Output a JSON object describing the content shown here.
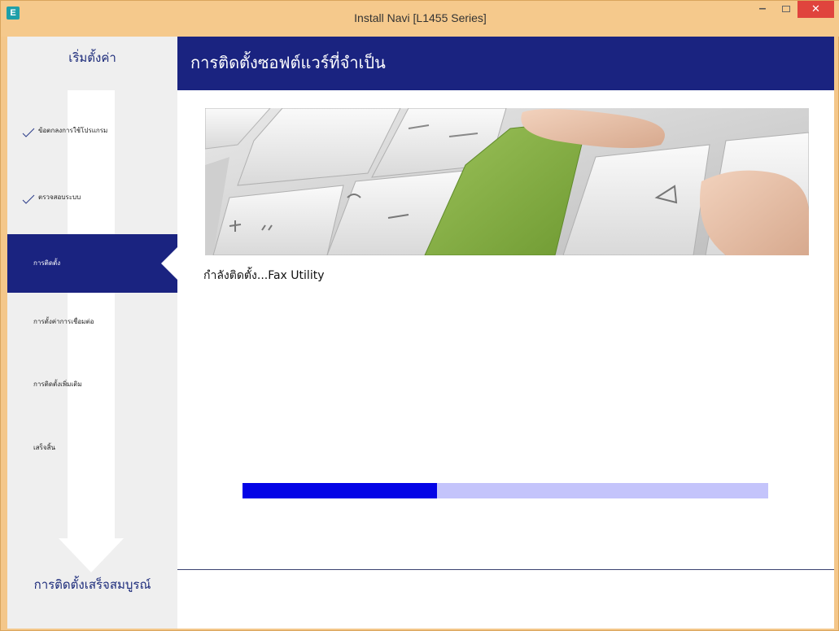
{
  "window": {
    "title": "Install Navi [L1455 Series]",
    "app_icon_letter": "E",
    "minimize_glyph": "–",
    "close_glyph": "✕"
  },
  "sidebar": {
    "title": "เริ่มตั้งค่า",
    "steps": [
      {
        "label": "ข้อตกลงการใช้โปรแกรม",
        "state": "done"
      },
      {
        "label": "ตรวจสอบระบบ",
        "state": "done"
      },
      {
        "label": "การติดตั้ง",
        "state": "active"
      },
      {
        "label": "การตั้งค่าการเชื่อมต่อ",
        "state": "pending"
      },
      {
        "label": "การติดตั้งเพิ่มเติม",
        "state": "pending"
      },
      {
        "label": "เสร็จสิ้น",
        "state": "pending"
      }
    ],
    "footer": "การติดตั้งเสร็จสมบูรณ์"
  },
  "main": {
    "header_title": "การติดตั้งซอฟต์แวร์ที่จำเป็น",
    "status_text": "กำลังติดตั้ง...Fax Utility",
    "progress_fraction": 0.37
  },
  "colors": {
    "accent": "#1a2380",
    "progress_fill": "#0404e6",
    "progress_track": "#c4c4fb",
    "close_button": "#e0443d"
  }
}
